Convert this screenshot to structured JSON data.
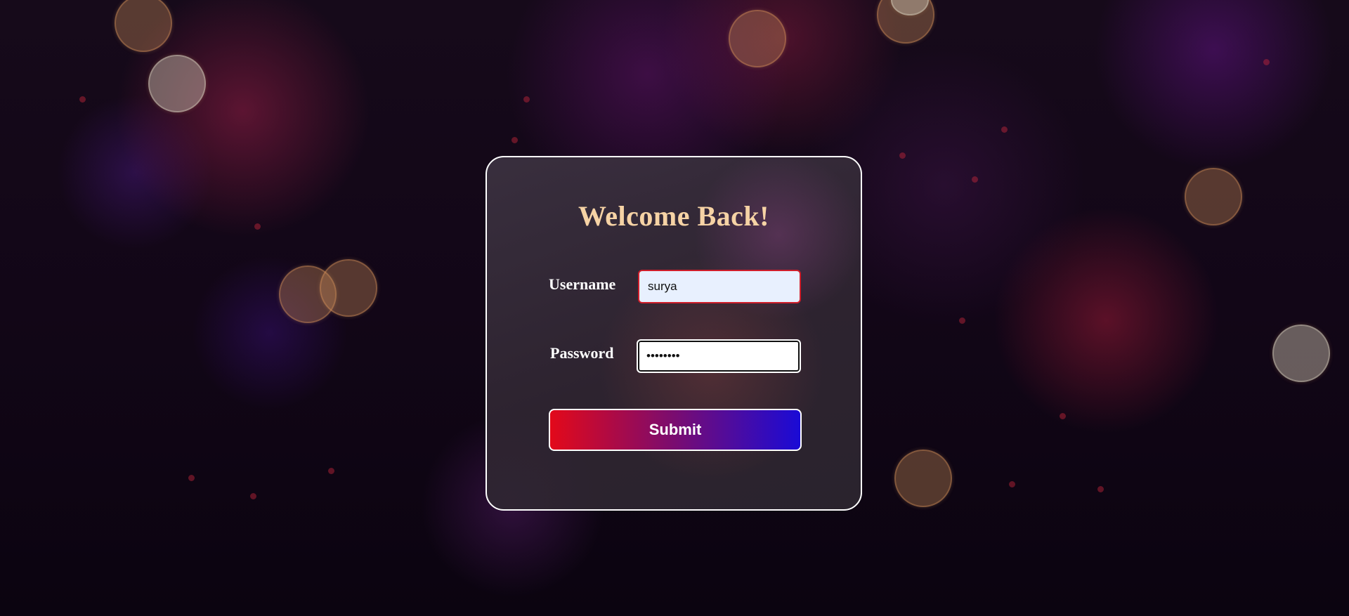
{
  "login_form": {
    "title": "Welcome Back!",
    "username_label": "Username",
    "username_value": "surya",
    "password_label": "Password",
    "password_value": "xxxxxxxx",
    "submit_label": "Submit"
  },
  "colors": {
    "title": "#f6d3a5",
    "username_border_active": "#d01e2a",
    "username_background": "#e8f0fe",
    "submit_gradient_start": "#e3091a",
    "submit_gradient_end": "#1a0bd6"
  }
}
